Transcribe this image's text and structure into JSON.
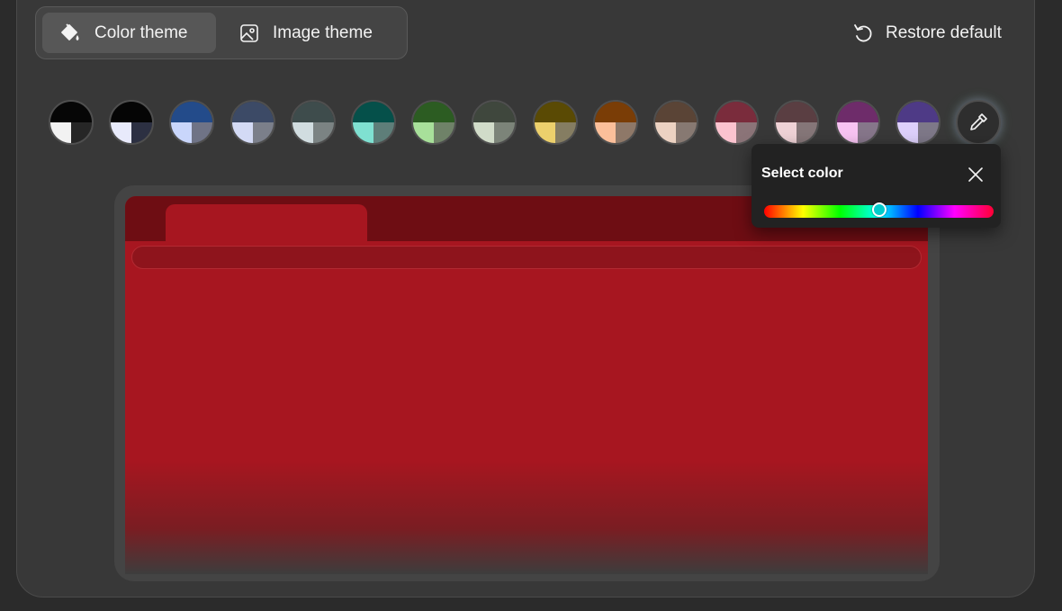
{
  "toolbar": {
    "color_theme_label": "Color theme",
    "image_theme_label": "Image theme",
    "restore_label": "Restore default"
  },
  "swatches": [
    {
      "name": "swatch-black-white",
      "top": "#060606",
      "bl": "#f2f2f2",
      "br": "#262626"
    },
    {
      "name": "swatch-black-lavender",
      "top": "#050505",
      "bl": "#e8eafb",
      "br": "#2c3042"
    },
    {
      "name": "swatch-blue",
      "top": "#234b8a",
      "bl": "#c9d6fb",
      "br": "#6f7386"
    },
    {
      "name": "swatch-slate-blue",
      "top": "#3c4a66",
      "bl": "#d3daf5",
      "br": "#7b7f8a"
    },
    {
      "name": "swatch-slate-gray",
      "top": "#3e4c4c",
      "bl": "#d1dde0",
      "br": "#7b8383"
    },
    {
      "name": "swatch-teal",
      "top": "#05504a",
      "bl": "#7fe0d1",
      "br": "#5e7e79"
    },
    {
      "name": "swatch-green",
      "top": "#2c5c22",
      "bl": "#a8e09a",
      "br": "#6f8268"
    },
    {
      "name": "swatch-gray-green",
      "top": "#3f473d",
      "bl": "#d1dcc9",
      "br": "#7c8479"
    },
    {
      "name": "swatch-olive",
      "top": "#5a4a04",
      "bl": "#ecd06c",
      "br": "#857d62"
    },
    {
      "name": "swatch-orange",
      "top": "#7a3d06",
      "bl": "#fbbf9a",
      "br": "#8e7868"
    },
    {
      "name": "swatch-brown",
      "top": "#5a4436",
      "bl": "#ecd2c2",
      "br": "#877972"
    },
    {
      "name": "swatch-raspberry",
      "top": "#7a2c3c",
      "bl": "#fbc3cf",
      "br": "#8b7478"
    },
    {
      "name": "swatch-mauve",
      "top": "#5a3e42",
      "bl": "#efd2d6",
      "br": "#857678"
    },
    {
      "name": "swatch-magenta",
      "top": "#6e2c6a",
      "bl": "#f7c3f2",
      "br": "#86768a"
    },
    {
      "name": "swatch-violet",
      "top": "#4e3a86",
      "bl": "#ddd0fb",
      "br": "#7e7888"
    }
  ],
  "popup": {
    "title": "Select color",
    "hue_value": 0.5
  }
}
